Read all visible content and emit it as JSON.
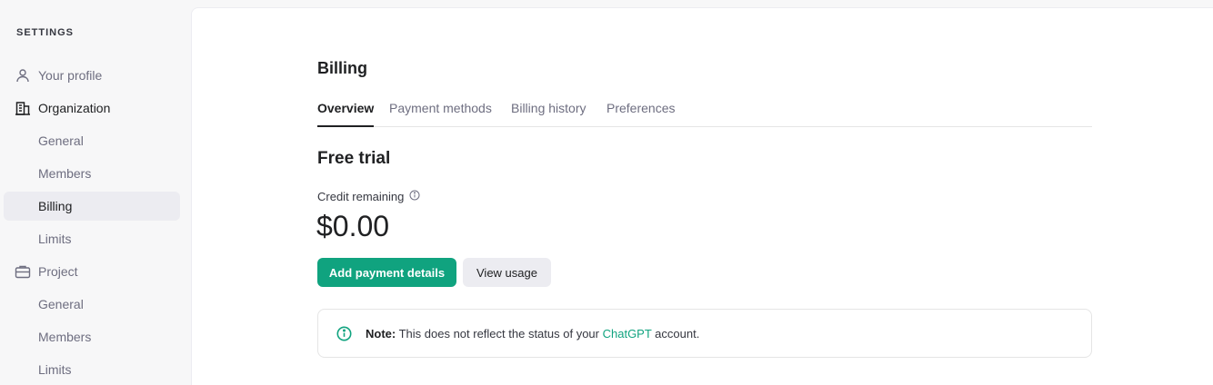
{
  "sidebar": {
    "heading": "SETTINGS",
    "items": [
      {
        "label": "Your profile",
        "icon": "person-icon"
      },
      {
        "label": "Organization",
        "icon": "building-icon"
      },
      {
        "label": "General"
      },
      {
        "label": "Members"
      },
      {
        "label": "Billing"
      },
      {
        "label": "Limits"
      },
      {
        "label": "Project",
        "icon": "briefcase-icon"
      },
      {
        "label": "General"
      },
      {
        "label": "Members"
      },
      {
        "label": "Limits"
      }
    ]
  },
  "page": {
    "title": "Billing",
    "tabs": [
      {
        "label": "Overview"
      },
      {
        "label": "Payment methods"
      },
      {
        "label": "Billing history"
      },
      {
        "label": "Preferences"
      }
    ],
    "plan_title": "Free trial",
    "credit_label": "Credit remaining",
    "credit_value": "$0.00",
    "buttons": {
      "add_payment": "Add payment details",
      "view_usage": "View usage"
    },
    "note": {
      "prefix": "Note:",
      "text_before": " This does not reflect the status of your ",
      "link": "ChatGPT",
      "text_after": " account."
    }
  },
  "colors": {
    "accent": "#10a37f",
    "active_bg": "#ececf1"
  }
}
